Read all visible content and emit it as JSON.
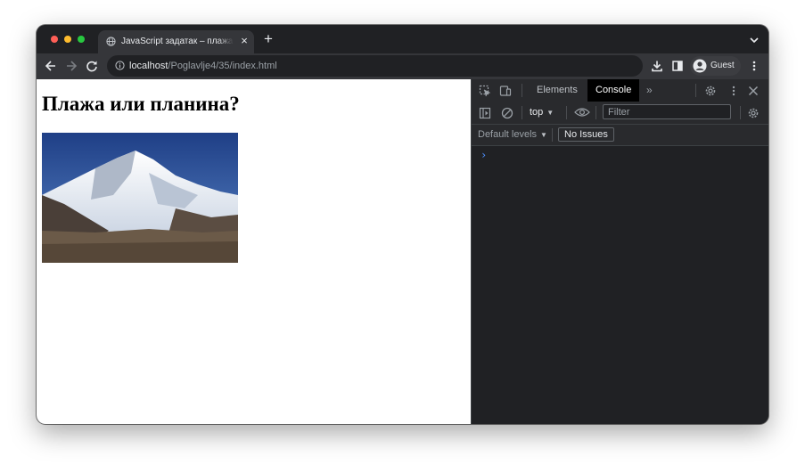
{
  "window": {
    "traffic_lights": [
      "close",
      "minimize",
      "zoom"
    ]
  },
  "tab": {
    "title": "JavaScript задатак – плажа или планина",
    "close_glyph": "×",
    "icon": "globe-icon"
  },
  "new_tab_glyph": "+",
  "address_bar": {
    "host": "localhost",
    "path": "/Poglavlje4/35/index.html",
    "icon": "info-icon"
  },
  "profile": {
    "label": "Guest"
  },
  "page": {
    "heading": "Плажа или планина?",
    "image": "mountain-photo"
  },
  "devtools": {
    "tabs": [
      {
        "label": "Elements",
        "active": false
      },
      {
        "label": "Console",
        "active": true
      }
    ],
    "context_select": "top",
    "filter_placeholder": "Filter",
    "levels_label": "Default levels",
    "issues_label": "No Issues",
    "prompt_glyph": "›"
  },
  "colors": {
    "chrome_dark": "#202124",
    "toolbar": "#35363a",
    "devtools_active_tab": "#000000",
    "console_prompt": "#4d90fe"
  }
}
